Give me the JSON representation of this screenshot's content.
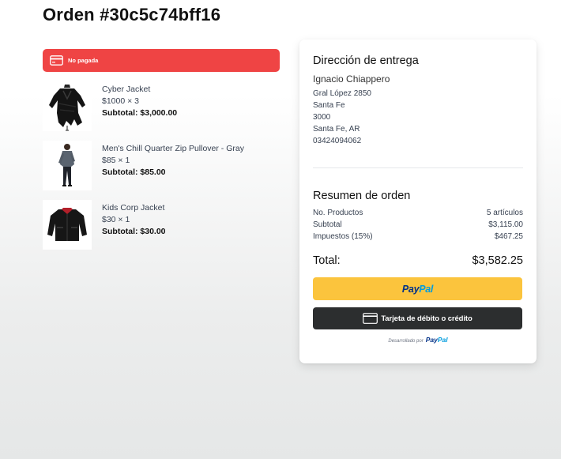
{
  "page": {
    "title": "Orden #30c5c74bff16"
  },
  "status": {
    "label": "No pagada",
    "color": "#ef4444"
  },
  "items": [
    {
      "name": "Cyber Jacket",
      "qty_price": "$1000 × 3",
      "subtotal": "Subtotal: $3,000.00",
      "image_icon": "black-jacket-on-mannequin"
    },
    {
      "name": "Men's Chill Quarter Zip Pullover - Gray",
      "qty_price": "$85 × 1",
      "subtotal": "Subtotal: $85.00",
      "image_icon": "man-in-gray-pullover"
    },
    {
      "name": "Kids Corp Jacket",
      "qty_price": "$30 × 1",
      "subtotal": "Subtotal: $30.00",
      "image_icon": "black-jacket-red-collar"
    }
  ],
  "delivery": {
    "title": "Dirección de entrega",
    "name": "Ignacio Chiappero",
    "street": "Gral López 2850",
    "city": "Santa Fe",
    "zip": "3000",
    "region": "Santa Fe, AR",
    "phone": "03424094062"
  },
  "summary": {
    "title": "Resumen de orden",
    "rows": [
      {
        "label": "No. Productos",
        "value": "5 artículos"
      },
      {
        "label": "Subtotal",
        "value": "$3,115.00"
      },
      {
        "label": "Impuestos (15%)",
        "value": "$467.25"
      }
    ],
    "total_label": "Total:",
    "total_value": "$3,582.25"
  },
  "payment": {
    "paypal_pay": "Pay",
    "paypal_pal": "Pal",
    "card_label": "Tarjeta de débito o crédito",
    "powered_by": "Desarrollado por",
    "powered_pay": "Pay",
    "powered_pal": "Pal",
    "paypal_button_color": "#fbc43d",
    "card_button_color": "#2c2e2f"
  }
}
